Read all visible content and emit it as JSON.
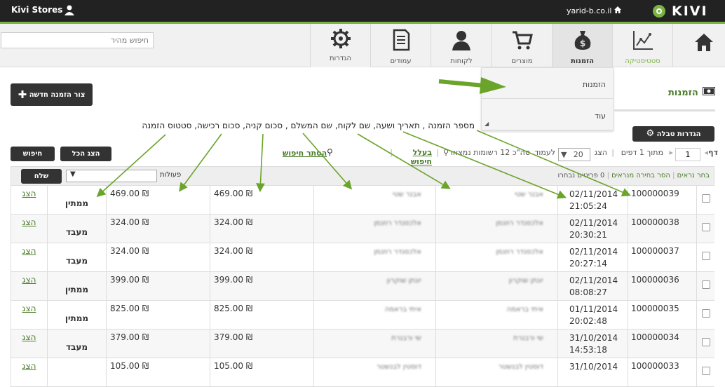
{
  "topbar": {
    "store_name": "Kivi Stores",
    "domain": "yarid-b.co.il",
    "brand": "KIVI"
  },
  "search": {
    "placeholder": "חיפוש מהיר"
  },
  "nav": [
    {
      "label": "סטטיסטיקה",
      "icon": "chart-icon"
    },
    {
      "label": "הזמנות",
      "icon": "money-bag-icon",
      "active": true
    },
    {
      "label": "מוצרים",
      "icon": "cart-icon"
    },
    {
      "label": "לקוחות",
      "icon": "person-icon"
    },
    {
      "label": "עמודים",
      "icon": "document-icon"
    },
    {
      "label": "הגדרות",
      "icon": "gear-icon"
    }
  ],
  "dropdown": {
    "items": [
      "הזמנות",
      "עוד"
    ]
  },
  "page": {
    "title": "הזמנות",
    "new_order": "צור הזמנה חדשה",
    "table_settings": "הגדרות טבלה"
  },
  "annotation": "מספר הזמנה , תאריך ושעה, שם לקוח, שם המשלם , סכום קניה, סכום רכישה, סטטוס הזמנה",
  "toolbar": {
    "find": "חיפוש",
    "show_all": "הצג הכל",
    "page_label": "דף",
    "page_value": "1",
    "of_pages": "מתוך 1 דפים",
    "show": "הצג",
    "per_page": "20",
    "per_page_label": "לעמוד",
    "total": "סה\"כ 12 רשומות נמצאו",
    "advanced_search": "בעלל חיפוש",
    "hide_search": "הסתר חיפוש"
  },
  "tablebar": {
    "send": "שלח",
    "actions_label": "פעולות",
    "select_visible": "בחר נראים",
    "clear_visible": "הסר בחירה מנראים",
    "selected_count": "0 פריטים נבחרו"
  },
  "orders": [
    {
      "num": "100000039",
      "date": "02/11/2014",
      "time": "21:05:24",
      "customer": "אבנר שטי",
      "payer": "אבנר שטי",
      "sum": "469.00 ₪",
      "total": "469.00 ₪",
      "status": "ממתין",
      "action": "הצג"
    },
    {
      "num": "100000038",
      "date": "02/11/2014",
      "time": "20:30:21",
      "customer": "אלכסנדר רוזנמן",
      "payer": "אלכסנדר רוזנמן",
      "sum": "324.00 ₪",
      "total": "324.00 ₪",
      "status": "מעבד",
      "action": "הצג"
    },
    {
      "num": "100000037",
      "date": "02/11/2014",
      "time": "20:27:14",
      "customer": "אלכסנדר רוזנמן",
      "payer": "אלכסנדר רוזנמן",
      "sum": "324.00 ₪",
      "total": "324.00 ₪",
      "status": "מעבד",
      "action": "הצג"
    },
    {
      "num": "100000036",
      "date": "02/11/2014",
      "time": "08:08:27",
      "customer": "יונתן שוקרון",
      "payer": "יונתן שוקרון",
      "sum": "399.00 ₪",
      "total": "399.00 ₪",
      "status": "ממתין",
      "action": "הצג"
    },
    {
      "num": "100000035",
      "date": "01/11/2014",
      "time": "20:02:48",
      "customer": "איתי בראמה",
      "payer": "איתי בראמה",
      "sum": "825.00 ₪",
      "total": "825.00 ₪",
      "status": "ממתין",
      "action": "הצג"
    },
    {
      "num": "100000034",
      "date": "31/10/2014",
      "time": "14:53:18",
      "customer": "שי ורבנרת",
      "payer": "שי ורבנרת",
      "sum": "379.00 ₪",
      "total": "379.00 ₪",
      "status": "מעבד",
      "action": "הצג"
    },
    {
      "num": "100000033",
      "date": "31/10/2014",
      "time": "",
      "customer": "דוסטין לבנשטר",
      "payer": "דוסטין לבנשטר",
      "sum": "105.00 ₪",
      "total": "105.00 ₪",
      "status": "",
      "action": "הצג"
    }
  ],
  "colors": {
    "accent": "#7cb342",
    "dark": "#333333",
    "title_green": "#4a7b2a",
    "topbar": "#222222"
  }
}
